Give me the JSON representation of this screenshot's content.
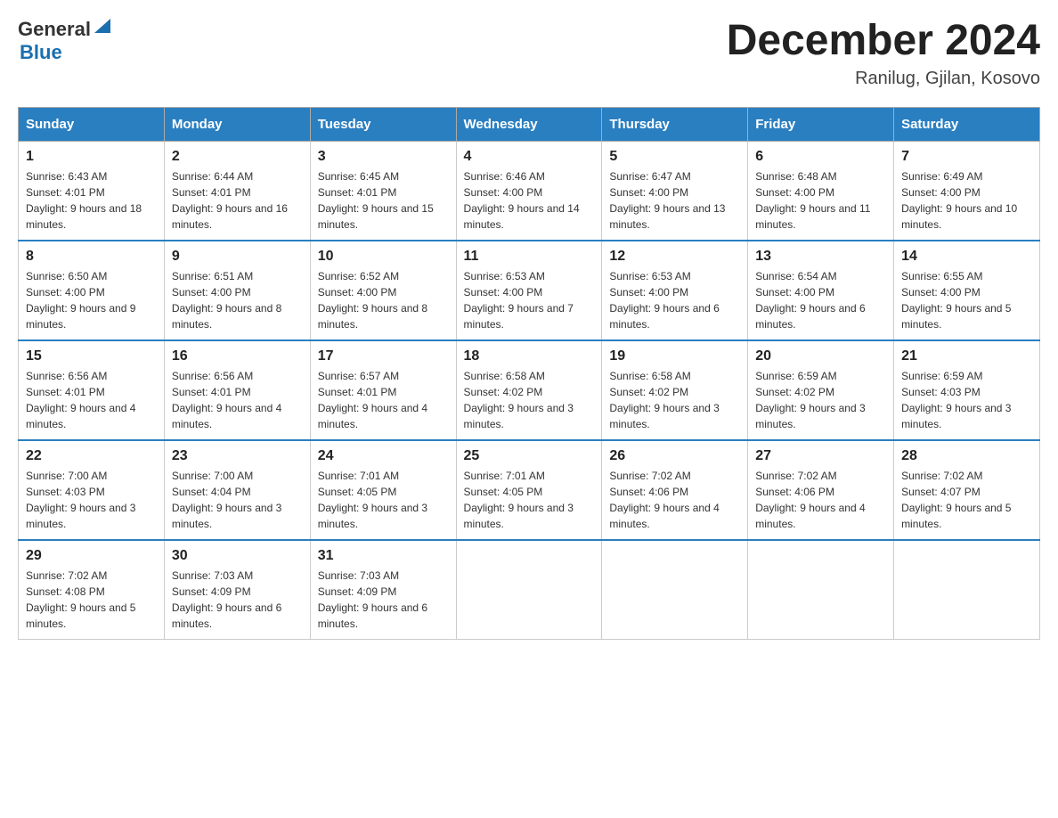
{
  "header": {
    "logo_general": "General",
    "logo_blue": "Blue",
    "title": "December 2024",
    "location": "Ranilug, Gjilan, Kosovo"
  },
  "days_of_week": [
    "Sunday",
    "Monday",
    "Tuesday",
    "Wednesday",
    "Thursday",
    "Friday",
    "Saturday"
  ],
  "weeks": [
    [
      {
        "day": "1",
        "sunrise": "Sunrise: 6:43 AM",
        "sunset": "Sunset: 4:01 PM",
        "daylight": "Daylight: 9 hours and 18 minutes."
      },
      {
        "day": "2",
        "sunrise": "Sunrise: 6:44 AM",
        "sunset": "Sunset: 4:01 PM",
        "daylight": "Daylight: 9 hours and 16 minutes."
      },
      {
        "day": "3",
        "sunrise": "Sunrise: 6:45 AM",
        "sunset": "Sunset: 4:01 PM",
        "daylight": "Daylight: 9 hours and 15 minutes."
      },
      {
        "day": "4",
        "sunrise": "Sunrise: 6:46 AM",
        "sunset": "Sunset: 4:00 PM",
        "daylight": "Daylight: 9 hours and 14 minutes."
      },
      {
        "day": "5",
        "sunrise": "Sunrise: 6:47 AM",
        "sunset": "Sunset: 4:00 PM",
        "daylight": "Daylight: 9 hours and 13 minutes."
      },
      {
        "day": "6",
        "sunrise": "Sunrise: 6:48 AM",
        "sunset": "Sunset: 4:00 PM",
        "daylight": "Daylight: 9 hours and 11 minutes."
      },
      {
        "day": "7",
        "sunrise": "Sunrise: 6:49 AM",
        "sunset": "Sunset: 4:00 PM",
        "daylight": "Daylight: 9 hours and 10 minutes."
      }
    ],
    [
      {
        "day": "8",
        "sunrise": "Sunrise: 6:50 AM",
        "sunset": "Sunset: 4:00 PM",
        "daylight": "Daylight: 9 hours and 9 minutes."
      },
      {
        "day": "9",
        "sunrise": "Sunrise: 6:51 AM",
        "sunset": "Sunset: 4:00 PM",
        "daylight": "Daylight: 9 hours and 8 minutes."
      },
      {
        "day": "10",
        "sunrise": "Sunrise: 6:52 AM",
        "sunset": "Sunset: 4:00 PM",
        "daylight": "Daylight: 9 hours and 8 minutes."
      },
      {
        "day": "11",
        "sunrise": "Sunrise: 6:53 AM",
        "sunset": "Sunset: 4:00 PM",
        "daylight": "Daylight: 9 hours and 7 minutes."
      },
      {
        "day": "12",
        "sunrise": "Sunrise: 6:53 AM",
        "sunset": "Sunset: 4:00 PM",
        "daylight": "Daylight: 9 hours and 6 minutes."
      },
      {
        "day": "13",
        "sunrise": "Sunrise: 6:54 AM",
        "sunset": "Sunset: 4:00 PM",
        "daylight": "Daylight: 9 hours and 6 minutes."
      },
      {
        "day": "14",
        "sunrise": "Sunrise: 6:55 AM",
        "sunset": "Sunset: 4:00 PM",
        "daylight": "Daylight: 9 hours and 5 minutes."
      }
    ],
    [
      {
        "day": "15",
        "sunrise": "Sunrise: 6:56 AM",
        "sunset": "Sunset: 4:01 PM",
        "daylight": "Daylight: 9 hours and 4 minutes."
      },
      {
        "day": "16",
        "sunrise": "Sunrise: 6:56 AM",
        "sunset": "Sunset: 4:01 PM",
        "daylight": "Daylight: 9 hours and 4 minutes."
      },
      {
        "day": "17",
        "sunrise": "Sunrise: 6:57 AM",
        "sunset": "Sunset: 4:01 PM",
        "daylight": "Daylight: 9 hours and 4 minutes."
      },
      {
        "day": "18",
        "sunrise": "Sunrise: 6:58 AM",
        "sunset": "Sunset: 4:02 PM",
        "daylight": "Daylight: 9 hours and 3 minutes."
      },
      {
        "day": "19",
        "sunrise": "Sunrise: 6:58 AM",
        "sunset": "Sunset: 4:02 PM",
        "daylight": "Daylight: 9 hours and 3 minutes."
      },
      {
        "day": "20",
        "sunrise": "Sunrise: 6:59 AM",
        "sunset": "Sunset: 4:02 PM",
        "daylight": "Daylight: 9 hours and 3 minutes."
      },
      {
        "day": "21",
        "sunrise": "Sunrise: 6:59 AM",
        "sunset": "Sunset: 4:03 PM",
        "daylight": "Daylight: 9 hours and 3 minutes."
      }
    ],
    [
      {
        "day": "22",
        "sunrise": "Sunrise: 7:00 AM",
        "sunset": "Sunset: 4:03 PM",
        "daylight": "Daylight: 9 hours and 3 minutes."
      },
      {
        "day": "23",
        "sunrise": "Sunrise: 7:00 AM",
        "sunset": "Sunset: 4:04 PM",
        "daylight": "Daylight: 9 hours and 3 minutes."
      },
      {
        "day": "24",
        "sunrise": "Sunrise: 7:01 AM",
        "sunset": "Sunset: 4:05 PM",
        "daylight": "Daylight: 9 hours and 3 minutes."
      },
      {
        "day": "25",
        "sunrise": "Sunrise: 7:01 AM",
        "sunset": "Sunset: 4:05 PM",
        "daylight": "Daylight: 9 hours and 3 minutes."
      },
      {
        "day": "26",
        "sunrise": "Sunrise: 7:02 AM",
        "sunset": "Sunset: 4:06 PM",
        "daylight": "Daylight: 9 hours and 4 minutes."
      },
      {
        "day": "27",
        "sunrise": "Sunrise: 7:02 AM",
        "sunset": "Sunset: 4:06 PM",
        "daylight": "Daylight: 9 hours and 4 minutes."
      },
      {
        "day": "28",
        "sunrise": "Sunrise: 7:02 AM",
        "sunset": "Sunset: 4:07 PM",
        "daylight": "Daylight: 9 hours and 5 minutes."
      }
    ],
    [
      {
        "day": "29",
        "sunrise": "Sunrise: 7:02 AM",
        "sunset": "Sunset: 4:08 PM",
        "daylight": "Daylight: 9 hours and 5 minutes."
      },
      {
        "day": "30",
        "sunrise": "Sunrise: 7:03 AM",
        "sunset": "Sunset: 4:09 PM",
        "daylight": "Daylight: 9 hours and 6 minutes."
      },
      {
        "day": "31",
        "sunrise": "Sunrise: 7:03 AM",
        "sunset": "Sunset: 4:09 PM",
        "daylight": "Daylight: 9 hours and 6 minutes."
      },
      null,
      null,
      null,
      null
    ]
  ]
}
